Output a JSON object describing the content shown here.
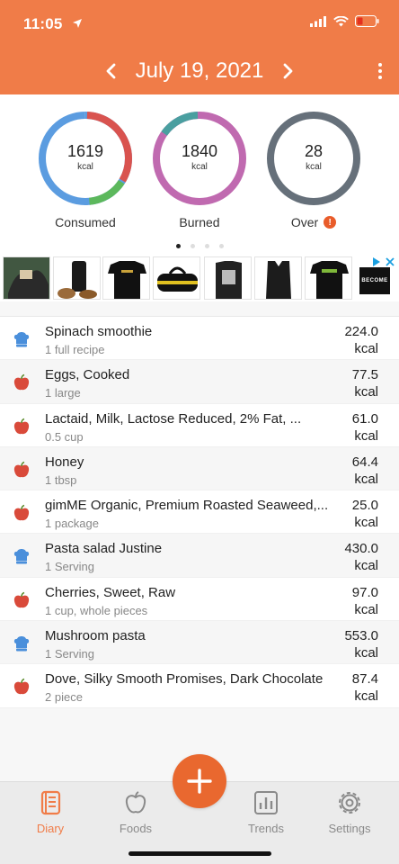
{
  "status": {
    "time": "11:05"
  },
  "header": {
    "date": "July 19, 2021"
  },
  "summary": {
    "consumed": {
      "value": "1619",
      "unit": "kcal",
      "label": "Consumed"
    },
    "burned": {
      "value": "1840",
      "unit": "kcal",
      "label": "Burned"
    },
    "over": {
      "value": "28",
      "unit": "kcal",
      "label": "Over",
      "warning": "!"
    }
  },
  "pager": {
    "pages": 4,
    "active": 1
  },
  "ad": {
    "logo_text": "BECOME"
  },
  "entries": [
    {
      "name": "Spinach smoothie",
      "portion": "1 full recipe",
      "kcal": "224.0",
      "unit": "kcal",
      "icon": "recipe-icon"
    },
    {
      "name": "Eggs, Cooked",
      "portion": "1 large",
      "kcal": "77.5",
      "unit": "kcal",
      "icon": "apple-icon"
    },
    {
      "name": "Lactaid, Milk, Lactose Reduced, 2% Fat, ...",
      "portion": "0.5 cup",
      "kcal": "61.0",
      "unit": "kcal",
      "icon": "apple-icon"
    },
    {
      "name": "Honey",
      "portion": "1 tbsp",
      "kcal": "64.4",
      "unit": "kcal",
      "icon": "apple-icon"
    },
    {
      "name": "gimME Organic, Premium Roasted Seaweed,...",
      "portion": "1 package",
      "kcal": "25.0",
      "unit": "kcal",
      "icon": "apple-icon"
    },
    {
      "name": "Pasta salad Justine",
      "portion": "1 Serving",
      "kcal": "430.0",
      "unit": "kcal",
      "icon": "recipe-icon"
    },
    {
      "name": "Cherries, Sweet, Raw",
      "portion": "1 cup, whole pieces",
      "kcal": "97.0",
      "unit": "kcal",
      "icon": "apple-icon"
    },
    {
      "name": "Mushroom pasta",
      "portion": "1 Serving",
      "kcal": "553.0",
      "unit": "kcal",
      "icon": "recipe-icon"
    },
    {
      "name": "Dove, Silky Smooth Promises, Dark Chocolate",
      "portion": "2 piece",
      "kcal": "87.4",
      "unit": "kcal",
      "icon": "apple-icon"
    }
  ],
  "tabs": {
    "diary": "Diary",
    "foods": "Foods",
    "trends": "Trends",
    "settings": "Settings"
  },
  "colors": {
    "brand": "#f07c48",
    "fab": "#e9682f",
    "consumed_blue": "#5b9ce0",
    "consumed_red": "#d9534f",
    "consumed_green": "#5cb85c",
    "burned_purple": "#c06ab0",
    "burned_teal": "#4a9fa0",
    "over_gray": "#66707a"
  }
}
